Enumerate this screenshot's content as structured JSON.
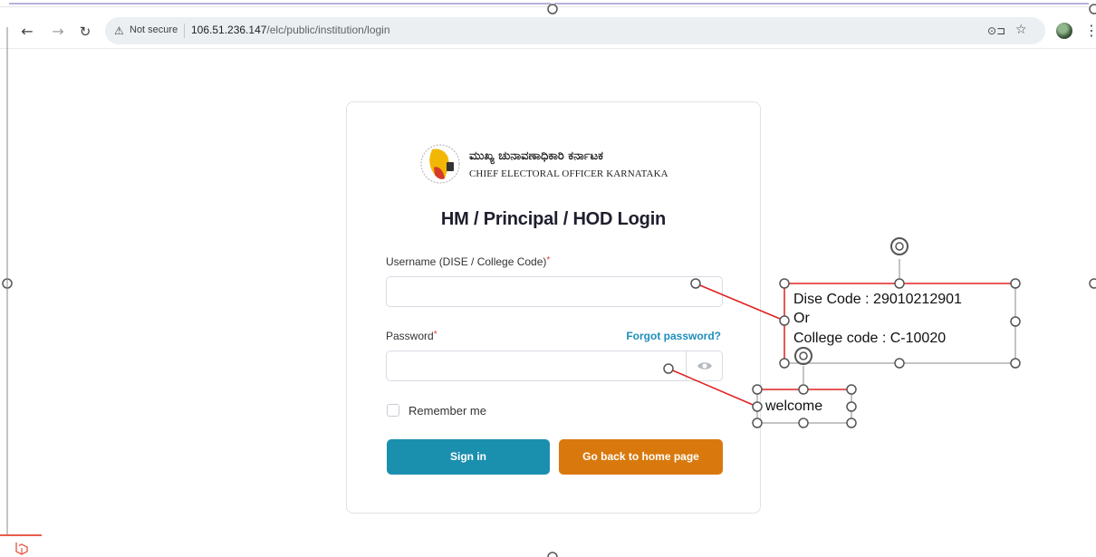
{
  "browser": {
    "not_secure": "Not secure",
    "url_host": "106.51.236.147",
    "url_path": "/elc/public/institution/login",
    "icons": [
      "back-arrow-icon",
      "forward-arrow-icon",
      "reload-icon",
      "warning-icon",
      "password-key-icon",
      "star-icon",
      "kebab-icon"
    ]
  },
  "logo": {
    "kannada": "ಮುಖ್ಯ ಚುನಾವಣಾಧಿಕಾರಿ ಕರ್ನಾಟಕ",
    "english": "CHIEF ELECTORAL OFFICER KARNATAKA"
  },
  "form": {
    "title": "HM / Principal / HOD Login",
    "username_label": "Username (DISE / College Code)",
    "username_value": "",
    "password_label": "Password",
    "password_value": "",
    "forgot": "Forgot password?",
    "remember": "Remember me",
    "required_mark": "*",
    "sign_in": "Sign in",
    "back_home": "Go back to home page"
  },
  "annotations": {
    "line1": "Dise Code : 29010212901",
    "line2": "Or",
    "line3": "College code : C-10020",
    "welcome": "welcome"
  },
  "colors": {
    "primary": "#1b8fae",
    "secondary": "#d9790d",
    "link": "#1f8ebc",
    "connector": "#e02020"
  }
}
